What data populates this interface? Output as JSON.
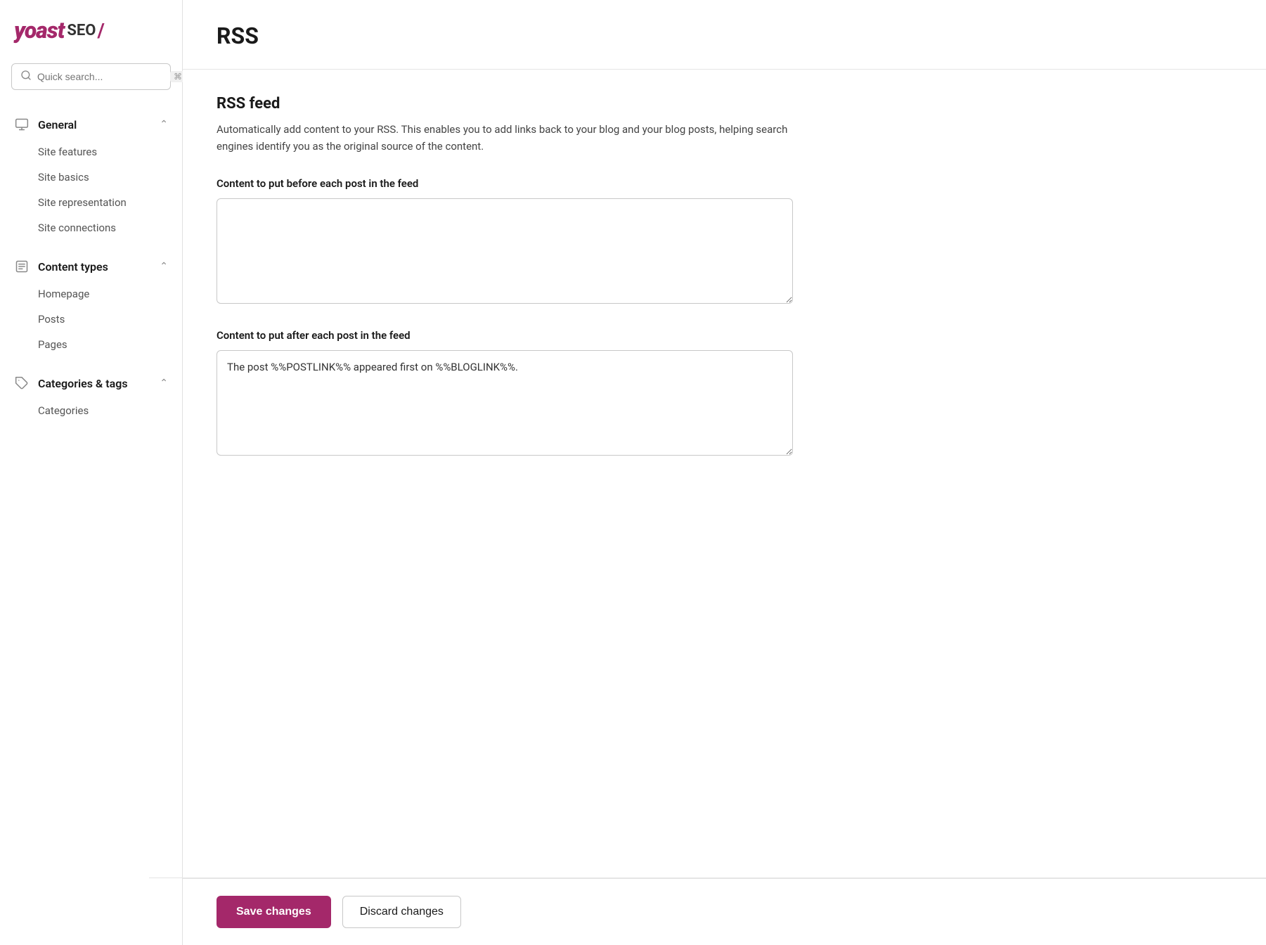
{
  "logo": {
    "yoast": "yoast",
    "seo": "SEO",
    "slash": "/"
  },
  "search": {
    "placeholder": "Quick search...",
    "shortcut": "⌘K"
  },
  "sidebar": {
    "sections": [
      {
        "id": "general",
        "icon": "monitor-icon",
        "title": "General",
        "expanded": true,
        "items": [
          {
            "id": "site-features",
            "label": "Site features"
          },
          {
            "id": "site-basics",
            "label": "Site basics"
          },
          {
            "id": "site-representation",
            "label": "Site representation"
          },
          {
            "id": "site-connections",
            "label": "Site connections"
          }
        ]
      },
      {
        "id": "content-types",
        "icon": "document-icon",
        "title": "Content types",
        "expanded": true,
        "items": [
          {
            "id": "homepage",
            "label": "Homepage"
          },
          {
            "id": "posts",
            "label": "Posts"
          },
          {
            "id": "pages",
            "label": "Pages"
          }
        ]
      },
      {
        "id": "categories-tags",
        "icon": "tag-icon",
        "title": "Categories & tags",
        "expanded": true,
        "items": [
          {
            "id": "categories",
            "label": "Categories"
          }
        ]
      }
    ]
  },
  "page": {
    "title": "RSS",
    "rss_feed": {
      "title": "RSS feed",
      "description": "Automatically add content to your RSS. This enables you to add links back to your blog and your blog posts, helping search engines identify you as the original source of the content.",
      "before_label": "Content to put before each post in the feed",
      "before_value": "",
      "after_label": "Content to put after each post in the feed",
      "after_value": "The post %%POSTLINK%% appeared first on %%BLOGLINK%%."
    }
  },
  "buttons": {
    "save": "Save changes",
    "discard": "Discard changes"
  }
}
